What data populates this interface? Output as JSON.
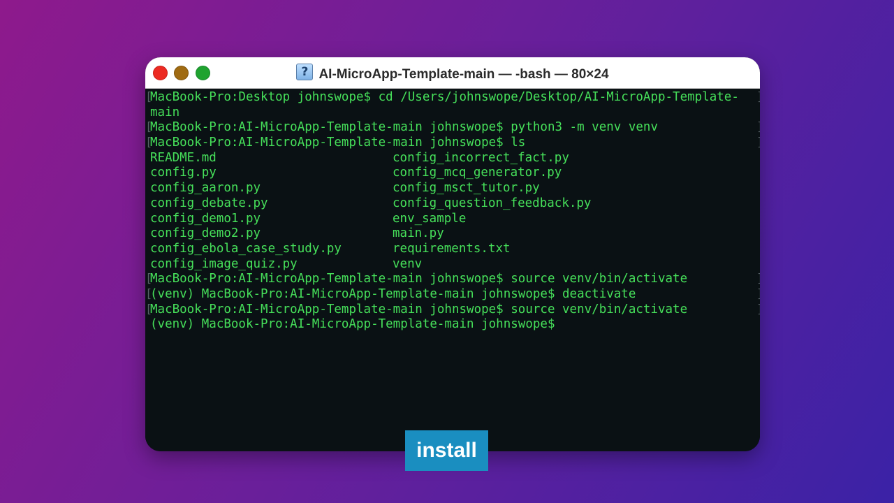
{
  "window": {
    "title": "AI-MicroApp-Template-main — -bash — 80×24",
    "title_icon": "folder-question-icon",
    "buttons": [
      "close",
      "minimize",
      "maximize"
    ]
  },
  "terminal": {
    "lines": [
      "MacBook-Pro:Desktop johnswope$ cd /Users/johnswope/Desktop/AI-MicroApp-Template-",
      "main",
      "MacBook-Pro:AI-MicroApp-Template-main johnswope$ python3 -m venv venv",
      "MacBook-Pro:AI-MicroApp-Template-main johnswope$ ls"
    ],
    "ls_left": [
      "README.md",
      "config.py",
      "config_aaron.py",
      "config_debate.py",
      "config_demo1.py",
      "config_demo2.py",
      "config_ebola_case_study.py",
      "config_image_quiz.py"
    ],
    "ls_right": [
      "config_incorrect_fact.py",
      "config_mcq_generator.py",
      "config_msct_tutor.py",
      "config_question_feedback.py",
      "env_sample",
      "main.py",
      "requirements.txt",
      "venv"
    ],
    "after_lines": [
      "MacBook-Pro:AI-MicroApp-Template-main johnswope$ source venv/bin/activate",
      "(venv) MacBook-Pro:AI-MicroApp-Template-main johnswope$ deactivate",
      "MacBook-Pro:AI-MicroApp-Template-main johnswope$ source venv/bin/activate",
      "(venv) MacBook-Pro:AI-MicroApp-Template-main johnswope$"
    ],
    "text_color": "#46e05a",
    "background": "#0a1114"
  },
  "badge": {
    "label": "install",
    "color": "#1a8ec0"
  }
}
